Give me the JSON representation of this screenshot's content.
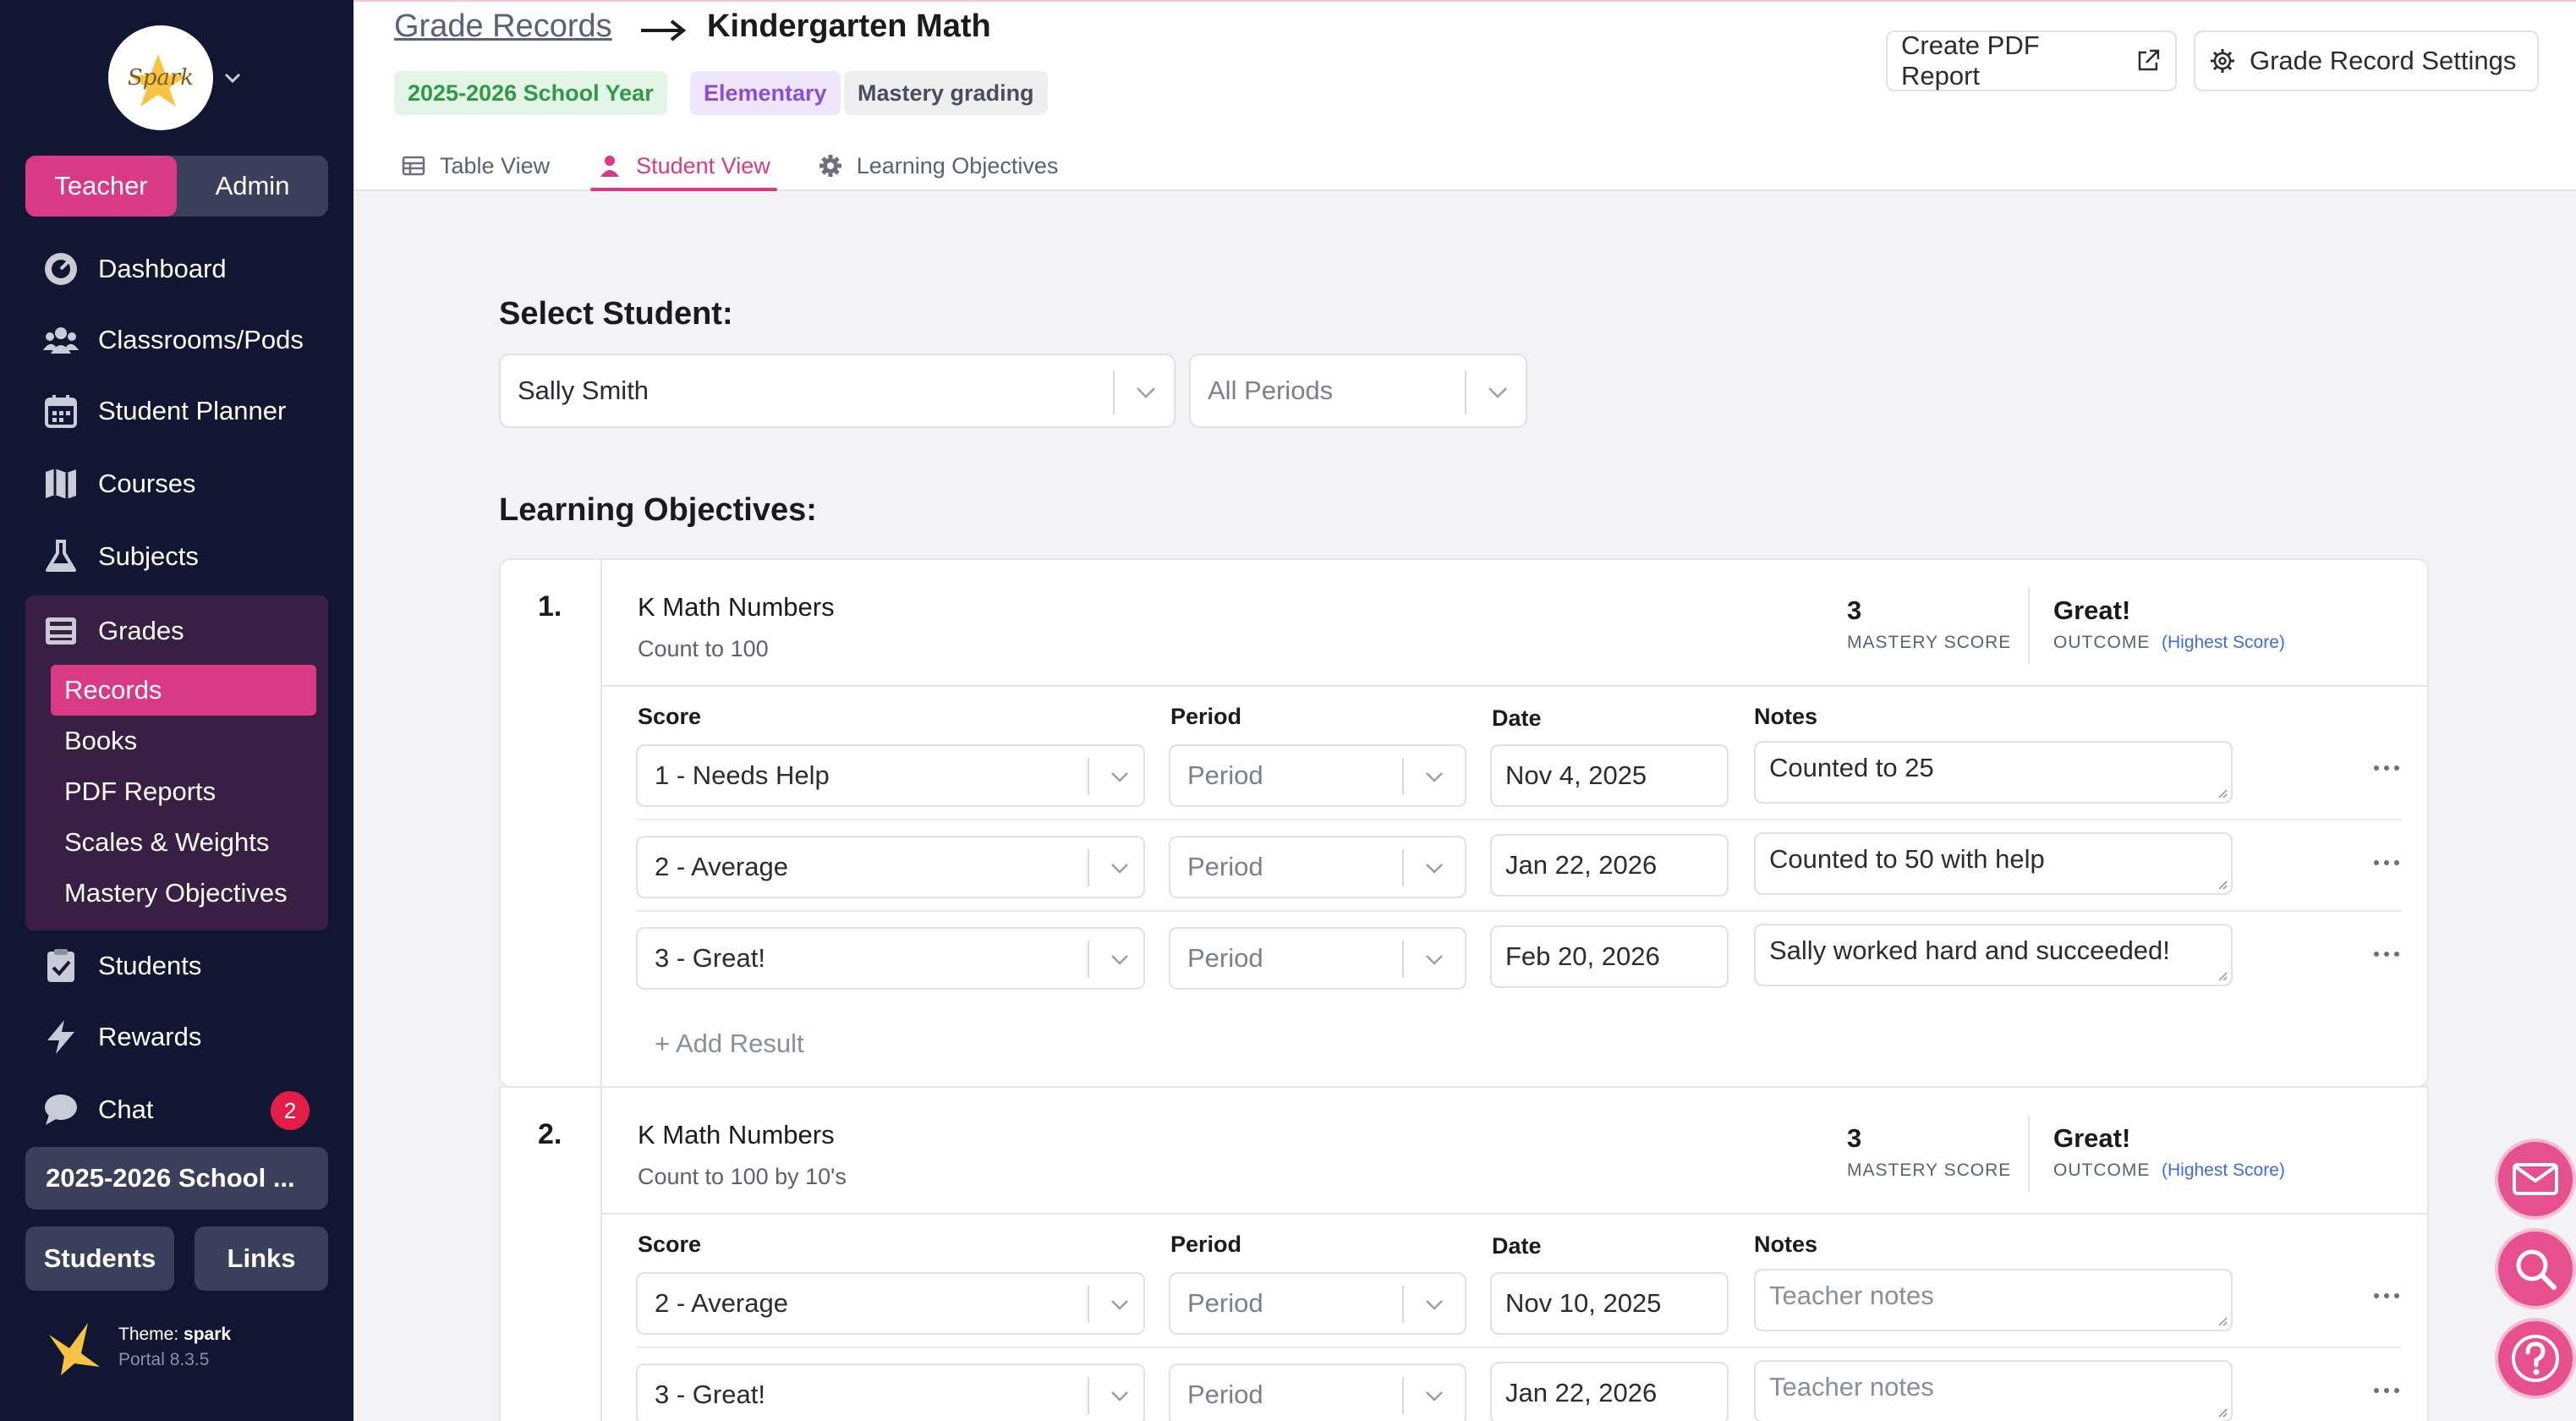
{
  "sidebar": {
    "brand": "Spark",
    "roles": [
      "Teacher",
      "Admin"
    ],
    "nav": [
      "Dashboard",
      "Classrooms/Pods",
      "Student Planner",
      "Courses",
      "Subjects",
      "Grades"
    ],
    "grades_sub": [
      "Records",
      "Books",
      "PDF Reports",
      "Scales & Weights",
      "Mastery Objectives"
    ],
    "nav_bottom": [
      "Students",
      "Rewards",
      "Chat"
    ],
    "chat_badge": "2",
    "year": "2025-2026 School ...",
    "buttons": [
      "Students",
      "Links"
    ],
    "theme_label": "Theme:",
    "theme_name": "spark",
    "version": "Portal 8.3.5"
  },
  "header": {
    "breadcrumb_link": "Grade Records",
    "title": "Kindergarten Math",
    "tags": [
      {
        "label": "2025-2026 School Year",
        "bg": "#e3f5e6",
        "fg": "#2f9a45"
      },
      {
        "label": "Elementary",
        "bg": "#efe6fb",
        "fg": "#8a4fd6"
      },
      {
        "label": "Mastery grading",
        "bg": "#efeff2",
        "fg": "#4a4d5a"
      }
    ],
    "tabs": [
      "Table View",
      "Student View",
      "Learning Objectives"
    ],
    "create_pdf": "Create PDF Report",
    "settings": "Grade Record Settings"
  },
  "main": {
    "select_student_title": "Select Student:",
    "student": "Sally Smith",
    "period": "All Periods",
    "objectives_title": "Learning Objectives:",
    "col_labels": {
      "score": "Score",
      "period": "Period",
      "date": "Date",
      "notes": "Notes"
    },
    "mastery_label": "MASTERY SCORE",
    "outcome_label": "OUTCOME",
    "highest": "(Highest Score)",
    "add_result": "+ Add Result",
    "period_placeholder": "Period",
    "notes_placeholder": "Teacher notes",
    "objectives": [
      {
        "num": "1.",
        "title": "K Math Numbers",
        "subtitle": "Count to 100",
        "mastery": "3",
        "outcome": "Great!",
        "results": [
          {
            "score": "1 - Needs Help",
            "date": "Nov 4, 2025",
            "notes": "Counted to 25"
          },
          {
            "score": "2 - Average",
            "date": "Jan 22, 2026",
            "notes": "Counted to 50 with help"
          },
          {
            "score": "3 - Great!",
            "date": "Feb 20, 2026",
            "notes": "Sally worked hard and succeeded!"
          }
        ]
      },
      {
        "num": "2.",
        "title": "K Math Numbers",
        "subtitle": "Count to 100 by 10's",
        "mastery": "3",
        "outcome": "Great!",
        "results": [
          {
            "score": "2 - Average",
            "date": "Nov 10, 2025",
            "notes": ""
          },
          {
            "score": "3 - Great!",
            "date": "Jan 22, 2026",
            "notes": ""
          }
        ]
      }
    ]
  },
  "colors": {
    "accent": "#d93a86",
    "sidebar": "#111733",
    "link": "#3b6fd8"
  }
}
